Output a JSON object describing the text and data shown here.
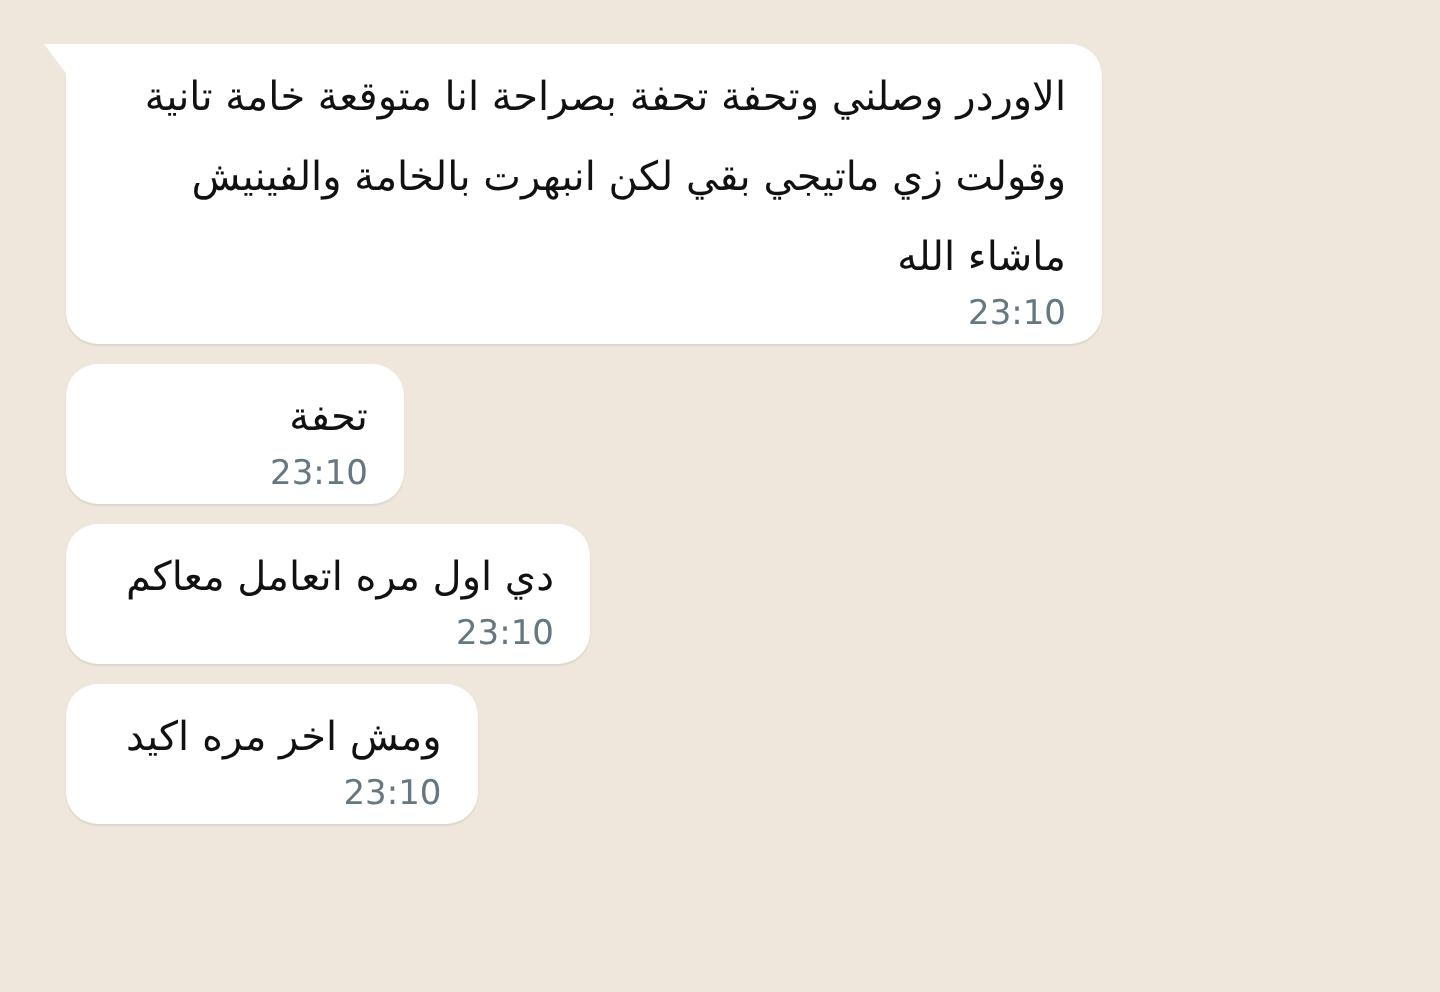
{
  "messages": [
    {
      "text": "الاوردر وصلني وتحفة تحفة بصراحة انا متوقعة خامة تانية وقولت زي ماتيجي بقي لكن انبهرت بالخامة والفينيش ماشاء الله",
      "time": "23:10",
      "tail": true
    },
    {
      "text": "تحفة",
      "time": "23:10",
      "tail": false
    },
    {
      "text": "دي اول مره اتعامل معاكم",
      "time": "23:10",
      "tail": false
    },
    {
      "text": "ومش اخر مره اكيد",
      "time": "23:10",
      "tail": false
    }
  ]
}
